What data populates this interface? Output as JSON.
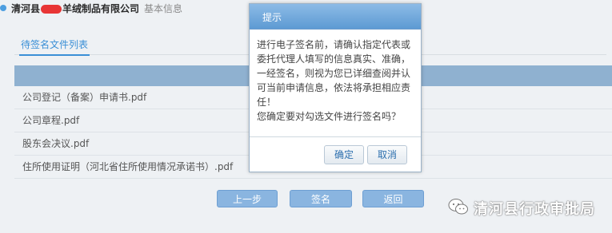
{
  "header": {
    "company_prefix": "清河县",
    "company_suffix": "羊绒制品有限公司",
    "basic_info": "基本信息"
  },
  "tab": {
    "label": "待签名文件列表"
  },
  "files": [
    "公司登记（备案）申请书.pdf",
    "公司章程.pdf",
    "股东会决议.pdf",
    "住所使用证明（河北省住所使用情况承诺书）.pdf"
  ],
  "buttons": {
    "prev": "上一步",
    "sign": "签名",
    "back": "返回"
  },
  "dialog": {
    "title": "提示",
    "message_lines": [
      "进行电子签名前，请确认指定代表或委托代理人填写的信息真实、准确，一经签名，则视为您已详细查阅并认可当前申请信息，依法将承担相应责任！",
      "您确定要对勾选文件进行签名吗？"
    ],
    "confirm": "确定",
    "cancel": "取消"
  },
  "watermark": {
    "text": "清河县行政审批局",
    "icon": "wechat-icon"
  },
  "colors": {
    "accent": "#3a8fd6",
    "header_bar": "#8fb1d0",
    "button": "#8ab5e0",
    "redaction": "#e83535"
  }
}
